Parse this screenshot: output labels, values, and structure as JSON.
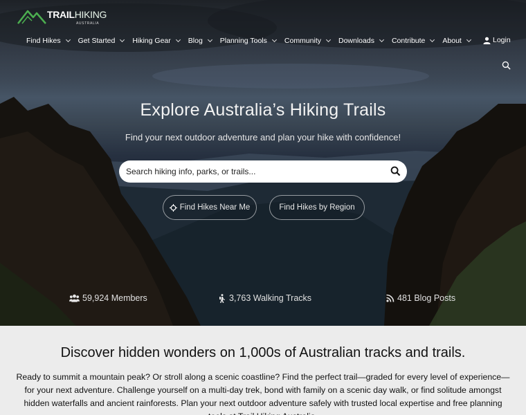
{
  "brand": {
    "name_bold": "TRAIL",
    "name_light": "HIKING",
    "tagline": "AUSTRALIA"
  },
  "nav": {
    "items": [
      {
        "label": "Find Hikes"
      },
      {
        "label": "Get Started"
      },
      {
        "label": "Hiking Gear"
      },
      {
        "label": "Blog"
      },
      {
        "label": "Planning Tools"
      },
      {
        "label": "Community"
      },
      {
        "label": "Downloads"
      },
      {
        "label": "Contribute"
      },
      {
        "label": "About"
      }
    ],
    "login_label": "Login"
  },
  "hero": {
    "title": "Explore Australia’s Hiking Trails",
    "subtitle": "Find your next outdoor adventure and plan your hike with confidence!",
    "search_placeholder": "Search hiking info, parks, or trails...",
    "near_me_label": "Find Hikes Near Me",
    "region_label": "Find Hikes by Region"
  },
  "stats": {
    "members": "59,924 Members",
    "tracks": "3,763 Walking Tracks",
    "posts": "481 Blog Posts"
  },
  "discover": {
    "heading": "Discover hidden wonders on 1,000s of Australian tracks and trails.",
    "body": "Ready to summit a mountain peak? Or stroll along a scenic coastline? Find the perfect trail—graded for every level of experience—for your next adventure. Challenge yourself on a multi-day trek, bond with family on a scenic day walk, or find solitude amongst hidden waterfalls and ancient rainforests. Plan your next outdoor adventure safely with trusted local expertise and free planning tools at Trail Hiking Australia."
  },
  "colors": {
    "logo_green": "#4caf50",
    "page_bg": "#ececec",
    "hero_text": "#f2f2f2"
  },
  "icons": [
    "mountain-logo-icon",
    "chevron-down-icon",
    "user-icon",
    "search-icon",
    "crosshair-icon",
    "users-icon",
    "hiker-icon",
    "rss-icon"
  ]
}
